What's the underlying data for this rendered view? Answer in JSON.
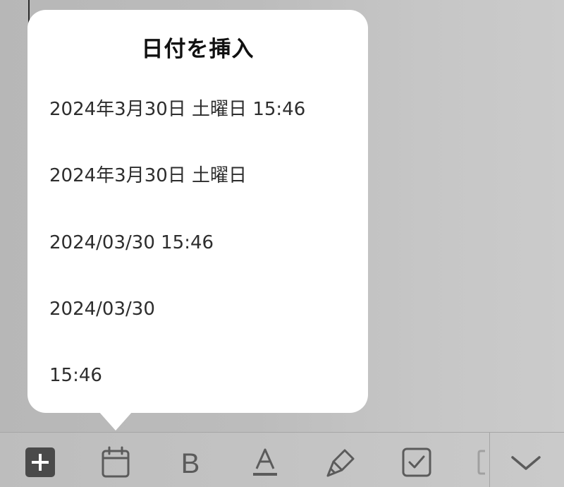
{
  "popover": {
    "title": "日付を挿入",
    "options": [
      "2024年3月30日 土曜日 15:46",
      "2024年3月30日 土曜日",
      "2024/03/30 15:46",
      "2024/03/30",
      "15:46"
    ]
  },
  "toolbar": {
    "items": [
      {
        "icon": "plus-square-icon"
      },
      {
        "icon": "calendar-icon"
      },
      {
        "icon": "bold-icon",
        "glyph": "B"
      },
      {
        "icon": "text-color-icon"
      },
      {
        "icon": "highlighter-icon"
      },
      {
        "icon": "checkbox-icon"
      },
      {
        "icon": "chevron-down-icon"
      }
    ]
  },
  "colors": {
    "popover_bg": "#ffffff",
    "icon_gray": "#5b5b5b",
    "plus_tile": "#4a4a4a"
  }
}
